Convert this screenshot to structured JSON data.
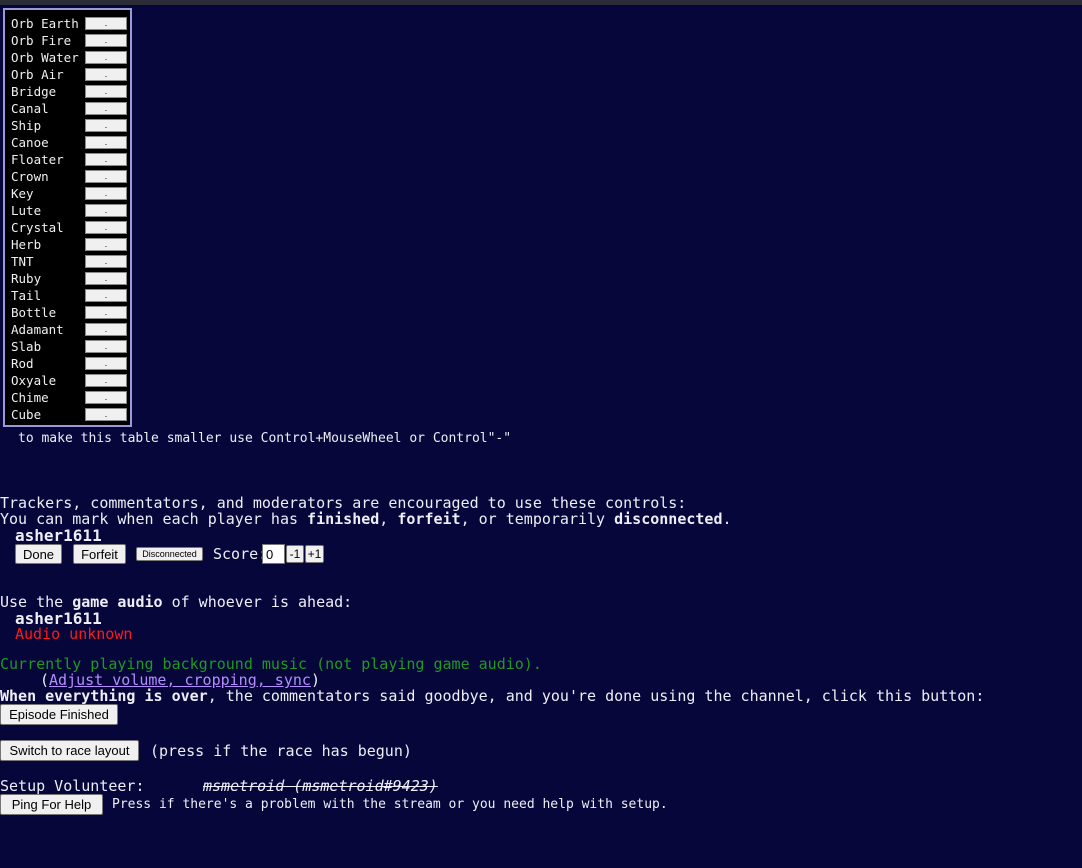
{
  "tracker": {
    "items": [
      {
        "label": "Orb Earth",
        "value": "."
      },
      {
        "label": "Orb Fire",
        "value": "."
      },
      {
        "label": "Orb Water",
        "value": "."
      },
      {
        "label": "Orb Air",
        "value": "."
      },
      {
        "label": "Bridge",
        "value": "."
      },
      {
        "label": "Canal",
        "value": "."
      },
      {
        "label": "Ship",
        "value": "."
      },
      {
        "label": "Canoe",
        "value": "."
      },
      {
        "label": "Floater",
        "value": "."
      },
      {
        "label": "Crown",
        "value": "."
      },
      {
        "label": "Key",
        "value": "."
      },
      {
        "label": "Lute",
        "value": "."
      },
      {
        "label": "Crystal",
        "value": "."
      },
      {
        "label": "Herb",
        "value": "."
      },
      {
        "label": "TNT",
        "value": "."
      },
      {
        "label": "Ruby",
        "value": "."
      },
      {
        "label": "Tail",
        "value": "."
      },
      {
        "label": "Bottle",
        "value": "."
      },
      {
        "label": "Adamant",
        "value": "."
      },
      {
        "label": "Slab",
        "value": "."
      },
      {
        "label": "Rod",
        "value": "."
      },
      {
        "label": "Oxyale",
        "value": "."
      },
      {
        "label": "Chime",
        "value": "."
      },
      {
        "label": "Cube",
        "value": "."
      }
    ],
    "resize_hint": "to make this table smaller use Control+MouseWheel or Control\"-\""
  },
  "controls": {
    "intro_line1": "Trackers, commentators, and moderators are encouraged to use these controls:",
    "intro_line2_prefix": "You can mark when each player has ",
    "finished": "finished",
    "comma1": ", ",
    "forfeit": "forfeit",
    "or_temp": ", or temporarily ",
    "disconnected": "disconnected",
    "period": ".",
    "player_name": "asher1611",
    "done_label": "Done",
    "forfeit_label": "Forfeit",
    "disconnected_label": "Disconnected",
    "score_label": "Score:",
    "score_value": "0",
    "minus_label": "-1",
    "plus_label": "+1"
  },
  "audio": {
    "prefix": "Use the ",
    "game_audio": "game audio",
    "suffix": " of whoever is ahead:",
    "player_name": "asher1611",
    "status": "Audio unknown",
    "bg_music": "Currently playing background music (not playing game audio).",
    "adjust_open": "(",
    "adjust_link": "Adjust volume, cropping, sync",
    "adjust_close": ")"
  },
  "finish": {
    "bold_part": "When everything is over",
    "rest": ", the commentators said goodbye, and you're done using the channel, click this button:",
    "episode_button": "Episode Finished",
    "race_button": "Switch to race layout",
    "race_hint": "(press if the race has begun)"
  },
  "setup": {
    "label": "Setup Volunteer:",
    "volunteer": "msmetroid (msmetroid#9423)",
    "ping_button": "Ping For Help",
    "ping_hint": "Press if there's a problem with the stream or you need help with setup."
  },
  "colors": {
    "background": "#06063a",
    "status_red": "#ff1a1a",
    "music_green": "#1e9a1e",
    "link_purple": "#b58cff"
  }
}
